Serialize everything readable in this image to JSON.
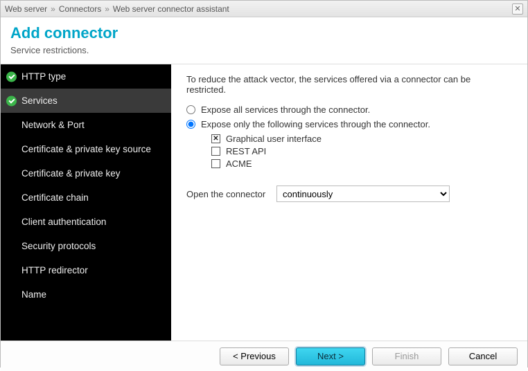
{
  "breadcrumb": {
    "p1": "Web server",
    "p2": "Connectors",
    "p3": "Web server connector assistant"
  },
  "header": {
    "title": "Add connector",
    "subtitle": "Service restrictions."
  },
  "sidebar": {
    "items": [
      {
        "label": "HTTP type"
      },
      {
        "label": "Services"
      },
      {
        "label": "Network & Port"
      },
      {
        "label": "Certificate & private key source"
      },
      {
        "label": "Certificate & private key"
      },
      {
        "label": "Certificate chain"
      },
      {
        "label": "Client authentication"
      },
      {
        "label": "Security protocols"
      },
      {
        "label": "HTTP redirector"
      },
      {
        "label": "Name"
      }
    ]
  },
  "content": {
    "intro": "To reduce the attack vector, the services offered via a connector can be restricted.",
    "radio_all": "Expose all services through the connector.",
    "radio_only": "Expose only the following services through the connector.",
    "services": {
      "gui": "Graphical user interface",
      "rest": "REST API",
      "acme": "ACME"
    },
    "open_label": "Open the connector",
    "open_value": "continuously"
  },
  "footer": {
    "previous": "< Previous",
    "next": "Next >",
    "finish": "Finish",
    "cancel": "Cancel"
  }
}
